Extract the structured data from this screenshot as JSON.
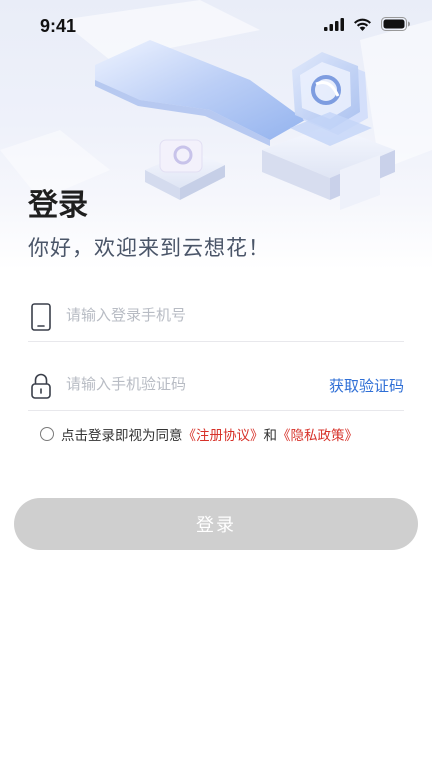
{
  "status_bar": {
    "time": "9:41"
  },
  "header": {
    "title": "登录",
    "subtitle": "你好，欢迎来到云想花！"
  },
  "form": {
    "phone_placeholder": "请输入登录手机号",
    "code_placeholder": "请输入手机验证码",
    "get_code_label": "获取验证码"
  },
  "agreement": {
    "prefix": "点击登录即视为同意",
    "terms_link": "《注册协议》",
    "and": "和",
    "privacy_link": "《隐私政策》",
    "checked": false
  },
  "login_button": {
    "label": "登录",
    "enabled": false
  },
  "colors": {
    "accent_blue": "#2f6fd6",
    "link_red": "#d7322a",
    "button_disabled": "#cfcfcf"
  }
}
